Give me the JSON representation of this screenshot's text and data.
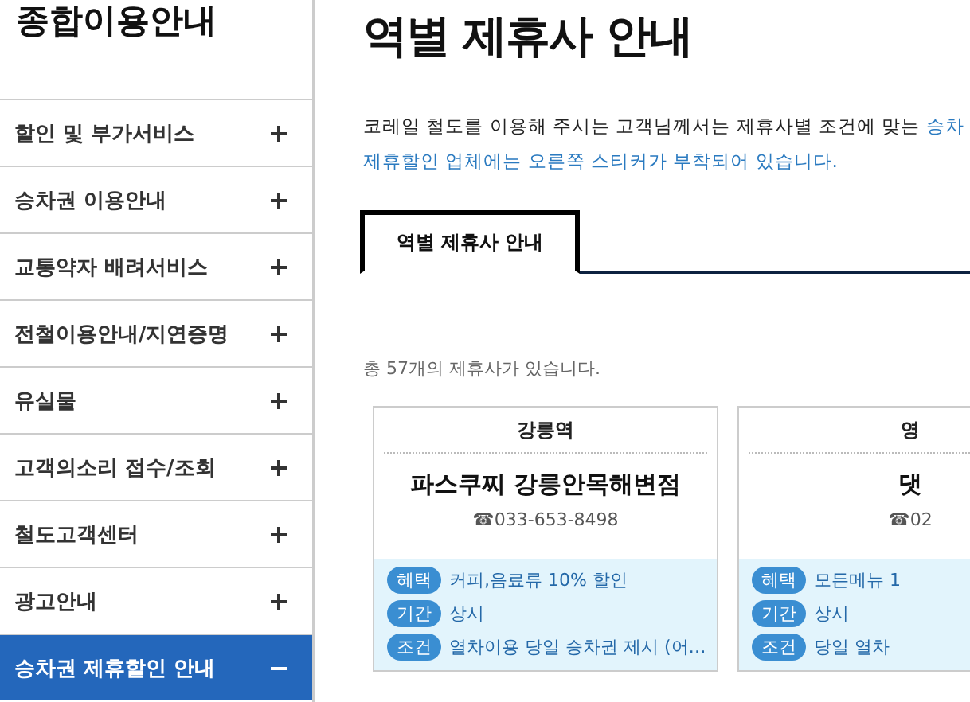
{
  "sidebar": {
    "title": "종합이용안내",
    "items": [
      {
        "label": "할인 및 부가서비스",
        "expanded": false
      },
      {
        "label": "승차권 이용안내",
        "expanded": false
      },
      {
        "label": "교통약자 배려서비스",
        "expanded": false
      },
      {
        "label": "전철이용안내/지연증명",
        "expanded": false
      },
      {
        "label": "유실물",
        "expanded": false
      },
      {
        "label": "고객의소리 접수/조회",
        "expanded": false
      },
      {
        "label": "철도고객센터",
        "expanded": false
      },
      {
        "label": "광고안내",
        "expanded": false
      },
      {
        "label": "승차권 제휴할인 안내",
        "expanded": true
      }
    ]
  },
  "main": {
    "title": "역별 제휴사 안내",
    "intro": [
      {
        "text": "코레일 철도를 이용해 주시는 고객님께서는 제휴사별 조건에 맞는 ",
        "highlight": "승차"
      },
      {
        "highlight": "제휴할인 업체에는 오른쪽 스티커가 부착되어 있습니다."
      }
    ],
    "tabs": [
      {
        "label": "역별 제휴사 안내",
        "selected": true
      }
    ],
    "count": "총 57개의 제휴사가 있습니다.",
    "cards": [
      {
        "station": "강릉역",
        "name": "파스쿠찌 강릉안목해변점",
        "phone": "☎033-653-8498",
        "details": [
          {
            "tag": "혜택",
            "value": "커피,음료류 10% 할인"
          },
          {
            "tag": "기간",
            "value": "상시"
          },
          {
            "tag": "조건",
            "value": "열차이용 당일 승차권 제시 (어…"
          }
        ]
      },
      {
        "station": "영",
        "name": "댓",
        "phone": "☎02",
        "details": [
          {
            "tag": "혜택",
            "value": "모든메뉴 1"
          },
          {
            "tag": "기간",
            "value": "상시"
          },
          {
            "tag": "조건",
            "value": "당일 열차"
          }
        ]
      }
    ]
  }
}
